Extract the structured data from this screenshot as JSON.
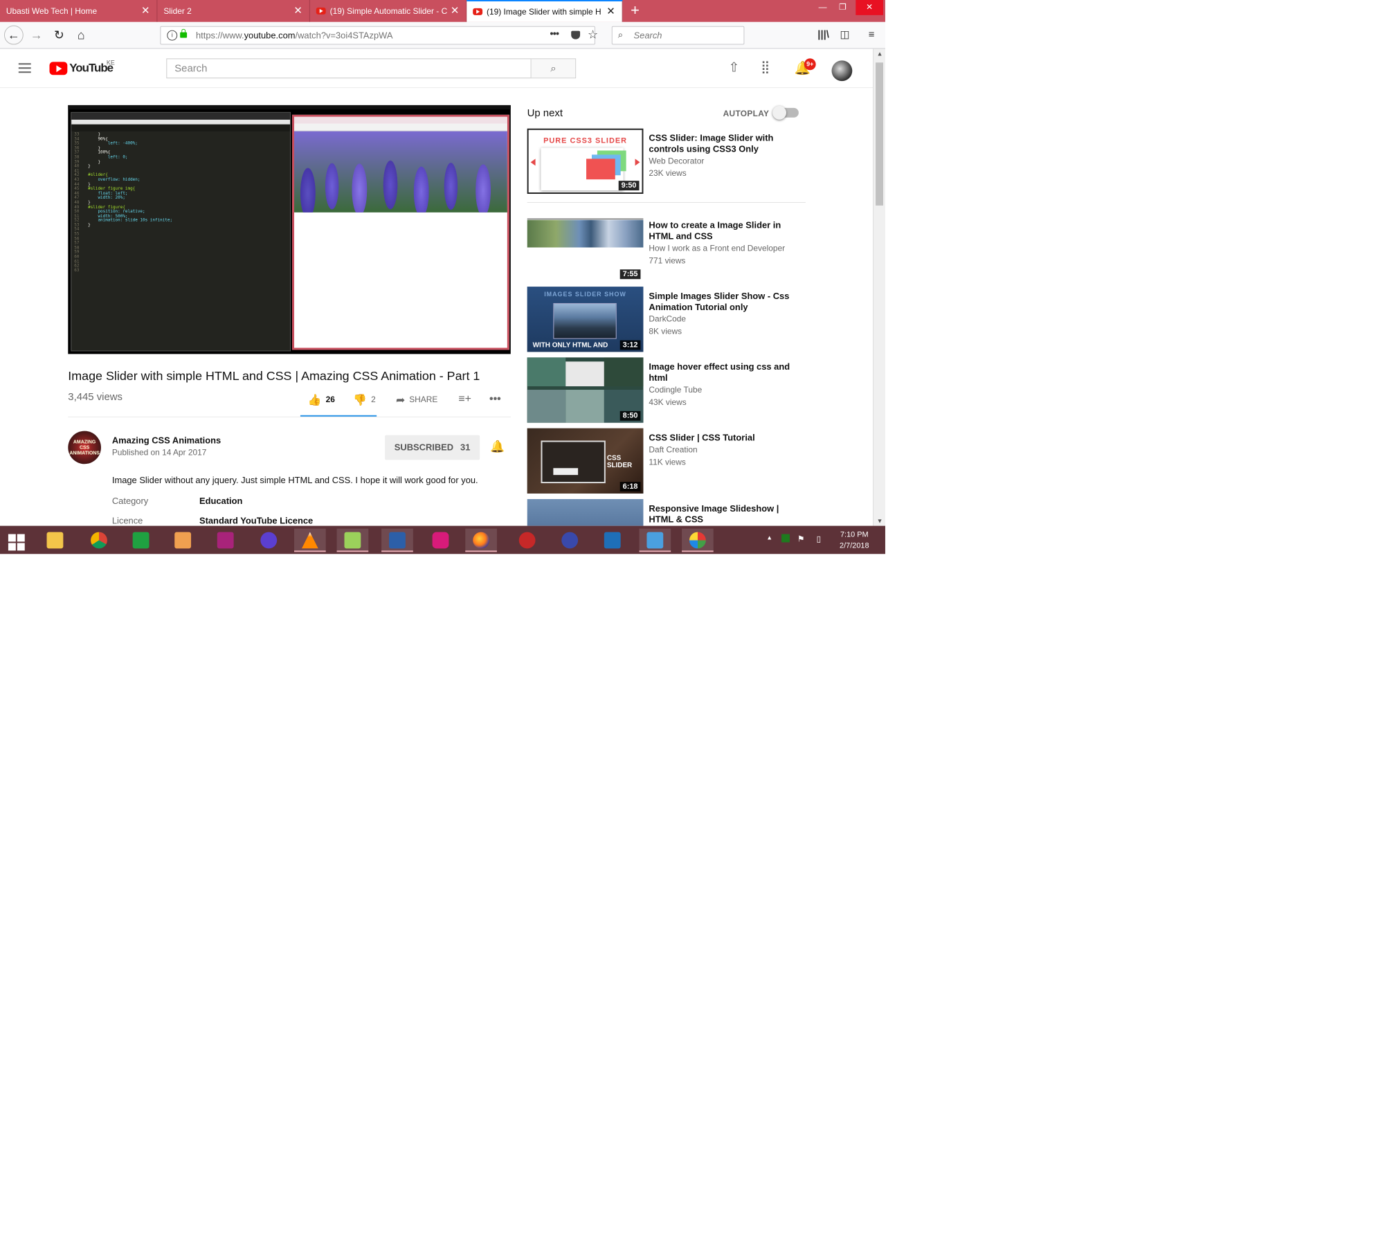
{
  "browser": {
    "tabs": [
      {
        "title": "Ubasti Web Tech | Home",
        "favicon": "none"
      },
      {
        "title": "Slider 2",
        "favicon": "none"
      },
      {
        "title": "(19) Simple Automatic Slider - C",
        "favicon": "youtube-icon"
      },
      {
        "title": "(19) Image Slider with simple H",
        "favicon": "youtube-icon",
        "active": true
      }
    ],
    "url_prefix": "https://www.",
    "url_domain": "youtube.com",
    "url_path": "/watch?v=3oi4STAzpWA",
    "search_placeholder": "Search",
    "colors": {
      "tabstrip": "#c94f5e",
      "accent": "#0a84ff"
    }
  },
  "youtube": {
    "logo_text": "YouTube",
    "region": "KE",
    "search_placeholder": "Search",
    "notification_count": "9+"
  },
  "video": {
    "title": "Image Slider with simple HTML and CSS | Amazing CSS Animation - Part 1",
    "views": "3,445 views",
    "likes": "26",
    "dislikes": "2",
    "share_label": "SHARE",
    "code_lines": [
      {
        "n": "33",
        "t": "    }"
      },
      {
        "n": "34",
        "t": "    90%{"
      },
      {
        "n": "35",
        "t": "        left: -400%;"
      },
      {
        "n": "36",
        "t": "    }"
      },
      {
        "n": "37",
        "t": "    100%{"
      },
      {
        "n": "38",
        "t": "        left: 0;"
      },
      {
        "n": "39",
        "t": "    }"
      },
      {
        "n": "40",
        "t": "}"
      },
      {
        "n": "41",
        "t": ""
      },
      {
        "n": "42",
        "t": "#slider{"
      },
      {
        "n": "43",
        "t": "    overflow: hidden;"
      },
      {
        "n": "44",
        "t": "}"
      },
      {
        "n": "45",
        "t": "#slider figure img{"
      },
      {
        "n": "46",
        "t": "    float: left;"
      },
      {
        "n": "47",
        "t": "    width: 20%;"
      },
      {
        "n": "48",
        "t": "}"
      },
      {
        "n": "49",
        "t": "#slider figure{"
      },
      {
        "n": "50",
        "t": "    position: relative;"
      },
      {
        "n": "51",
        "t": "    width: 500%;"
      },
      {
        "n": "52",
        "t": "    animation: slide 10s infinite;"
      },
      {
        "n": "53",
        "t": "}"
      },
      {
        "n": "54",
        "t": ""
      },
      {
        "n": "55",
        "t": ""
      },
      {
        "n": "56",
        "t": ""
      },
      {
        "n": "57",
        "t": ""
      },
      {
        "n": "58",
        "t": ""
      },
      {
        "n": "59",
        "t": ""
      },
      {
        "n": "60",
        "t": ""
      },
      {
        "n": "61",
        "t": ""
      },
      {
        "n": "62",
        "t": ""
      },
      {
        "n": "63",
        "t": ""
      }
    ]
  },
  "channel": {
    "name": "Amazing CSS Animations",
    "published": "Published on 14 Apr 2017",
    "subscribe_label": "SUBSCRIBED",
    "subscriber_count": "31",
    "avatar_text": "AMAZING CSS ANIMATIONS"
  },
  "description": {
    "text": "Image Slider without any jquery. Just simple HTML and CSS. I hope it will work good for you.",
    "category_label": "Category",
    "category_value": "Education",
    "licence_label": "Licence",
    "licence_value": "Standard YouTube Licence"
  },
  "sidebar": {
    "up_next_label": "Up next",
    "autoplay_label": "AUTOPLAY",
    "autoplay_on": false,
    "videos": [
      {
        "title": "CSS Slider: Image Slider with controls using CSS3 Only",
        "channel": "Web Decorator",
        "views": "23K views",
        "duration": "9:50",
        "thumb_text": "PURE CSS3 SLIDER"
      },
      {
        "title": "How to create a Image Slider in HTML and CSS",
        "channel": "How I work as a Front end Developer",
        "views": "771 views",
        "duration": "7:55"
      },
      {
        "title": "Simple Images Slider Show - Css Animation Tutorial only",
        "channel": "DarkCode",
        "views": "8K views",
        "duration": "3:12",
        "thumb_text": "IMAGES SLIDER SHOW",
        "thumb_text2": "WITH ONLY HTML AND"
      },
      {
        "title": "Image hover effect using css and html",
        "channel": "Codingle Tube",
        "views": "43K views",
        "duration": "8:50"
      },
      {
        "title": "CSS Slider | CSS Tutorial",
        "channel": "Daft Creation",
        "views": "11K views",
        "duration": "6:18",
        "thumb_text": "CSS SLIDER"
      },
      {
        "title": "Responsive Image Slideshow | HTML & CSS"
      }
    ]
  },
  "taskbar": {
    "time": "7:10 PM",
    "date": "2/7/2018"
  }
}
